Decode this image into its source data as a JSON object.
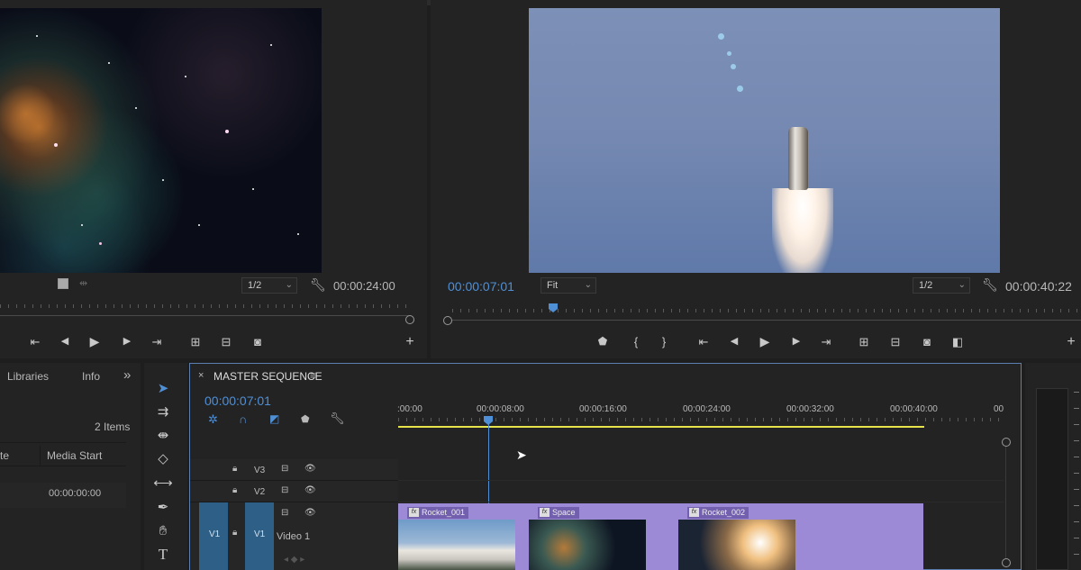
{
  "source_monitor": {
    "timecode": "00:00:24:00",
    "resolution": "1/2"
  },
  "program_monitor": {
    "timecode_current": "00:00:07:01",
    "timecode_duration": "00:00:40:22",
    "zoom": "Fit",
    "resolution": "1/2"
  },
  "project_panel": {
    "tab_libraries": "Libraries",
    "tab_info": "Info",
    "expand": "»",
    "items_count": "2 Items",
    "col_rate": "te",
    "col_media_start": "Media Start",
    "media_start_value": "00:00:00:00"
  },
  "timeline": {
    "close": "×",
    "title": "MASTER SEQUENCE",
    "menu": "≡",
    "timecode": "00:00:07:01",
    "ruler_labels": [
      ":00:00",
      "00:00:08:00",
      "00:00:16:00",
      "00:00:24:00",
      "00:00:32:00",
      "00:00:40:00",
      "00"
    ],
    "tracks": [
      {
        "name": "V3"
      },
      {
        "name": "V2"
      },
      {
        "name": "V1",
        "source": "V1",
        "label": "Video 1"
      }
    ],
    "clips": [
      {
        "name": "Rocket_001"
      },
      {
        "name": "Space"
      },
      {
        "name": "Rocket_002"
      }
    ]
  },
  "colors": {
    "accent_blue": "#4f8fd6",
    "clip_purple": "#9c8ad6",
    "work_area_yellow": "#e6e24a"
  }
}
